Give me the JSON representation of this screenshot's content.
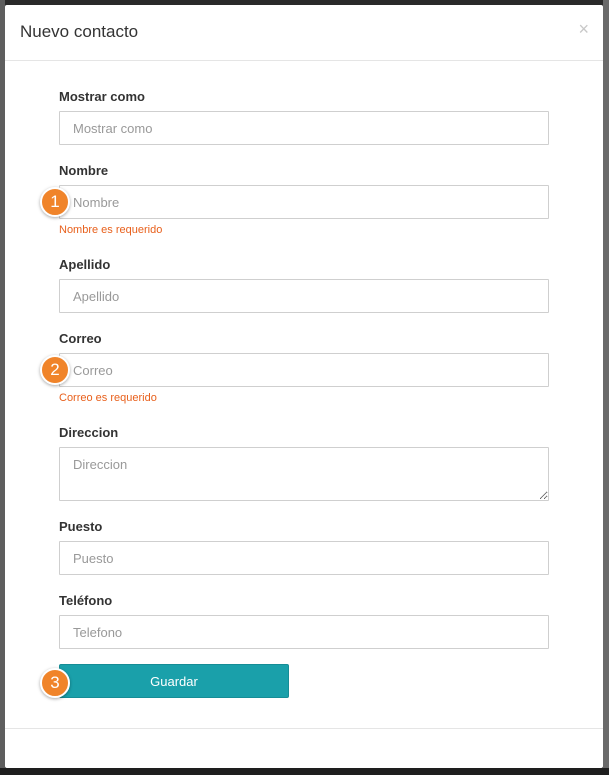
{
  "modal": {
    "title": "Nuevo contacto",
    "close_label": "×"
  },
  "form": {
    "display_as": {
      "label": "Mostrar como",
      "placeholder": "Mostrar como",
      "value": ""
    },
    "first_name": {
      "label": "Nombre",
      "placeholder": "Nombre",
      "value": "",
      "error": "Nombre es requerido"
    },
    "last_name": {
      "label": "Apellido",
      "placeholder": "Apellido",
      "value": ""
    },
    "email": {
      "label": "Correo",
      "placeholder": "Correo",
      "value": "",
      "error": "Correo es requerido"
    },
    "address": {
      "label": "Direccion",
      "placeholder": "Direccion",
      "value": ""
    },
    "position": {
      "label": "Puesto",
      "placeholder": "Puesto",
      "value": ""
    },
    "phone": {
      "label": "Teléfono",
      "placeholder": "Telefono",
      "value": ""
    },
    "submit_label": "Guardar"
  },
  "markers": [
    "1",
    "2",
    "3"
  ],
  "colors": {
    "accent": "#1aa0aa",
    "error": "#e8601c",
    "marker": "#f0842a"
  }
}
